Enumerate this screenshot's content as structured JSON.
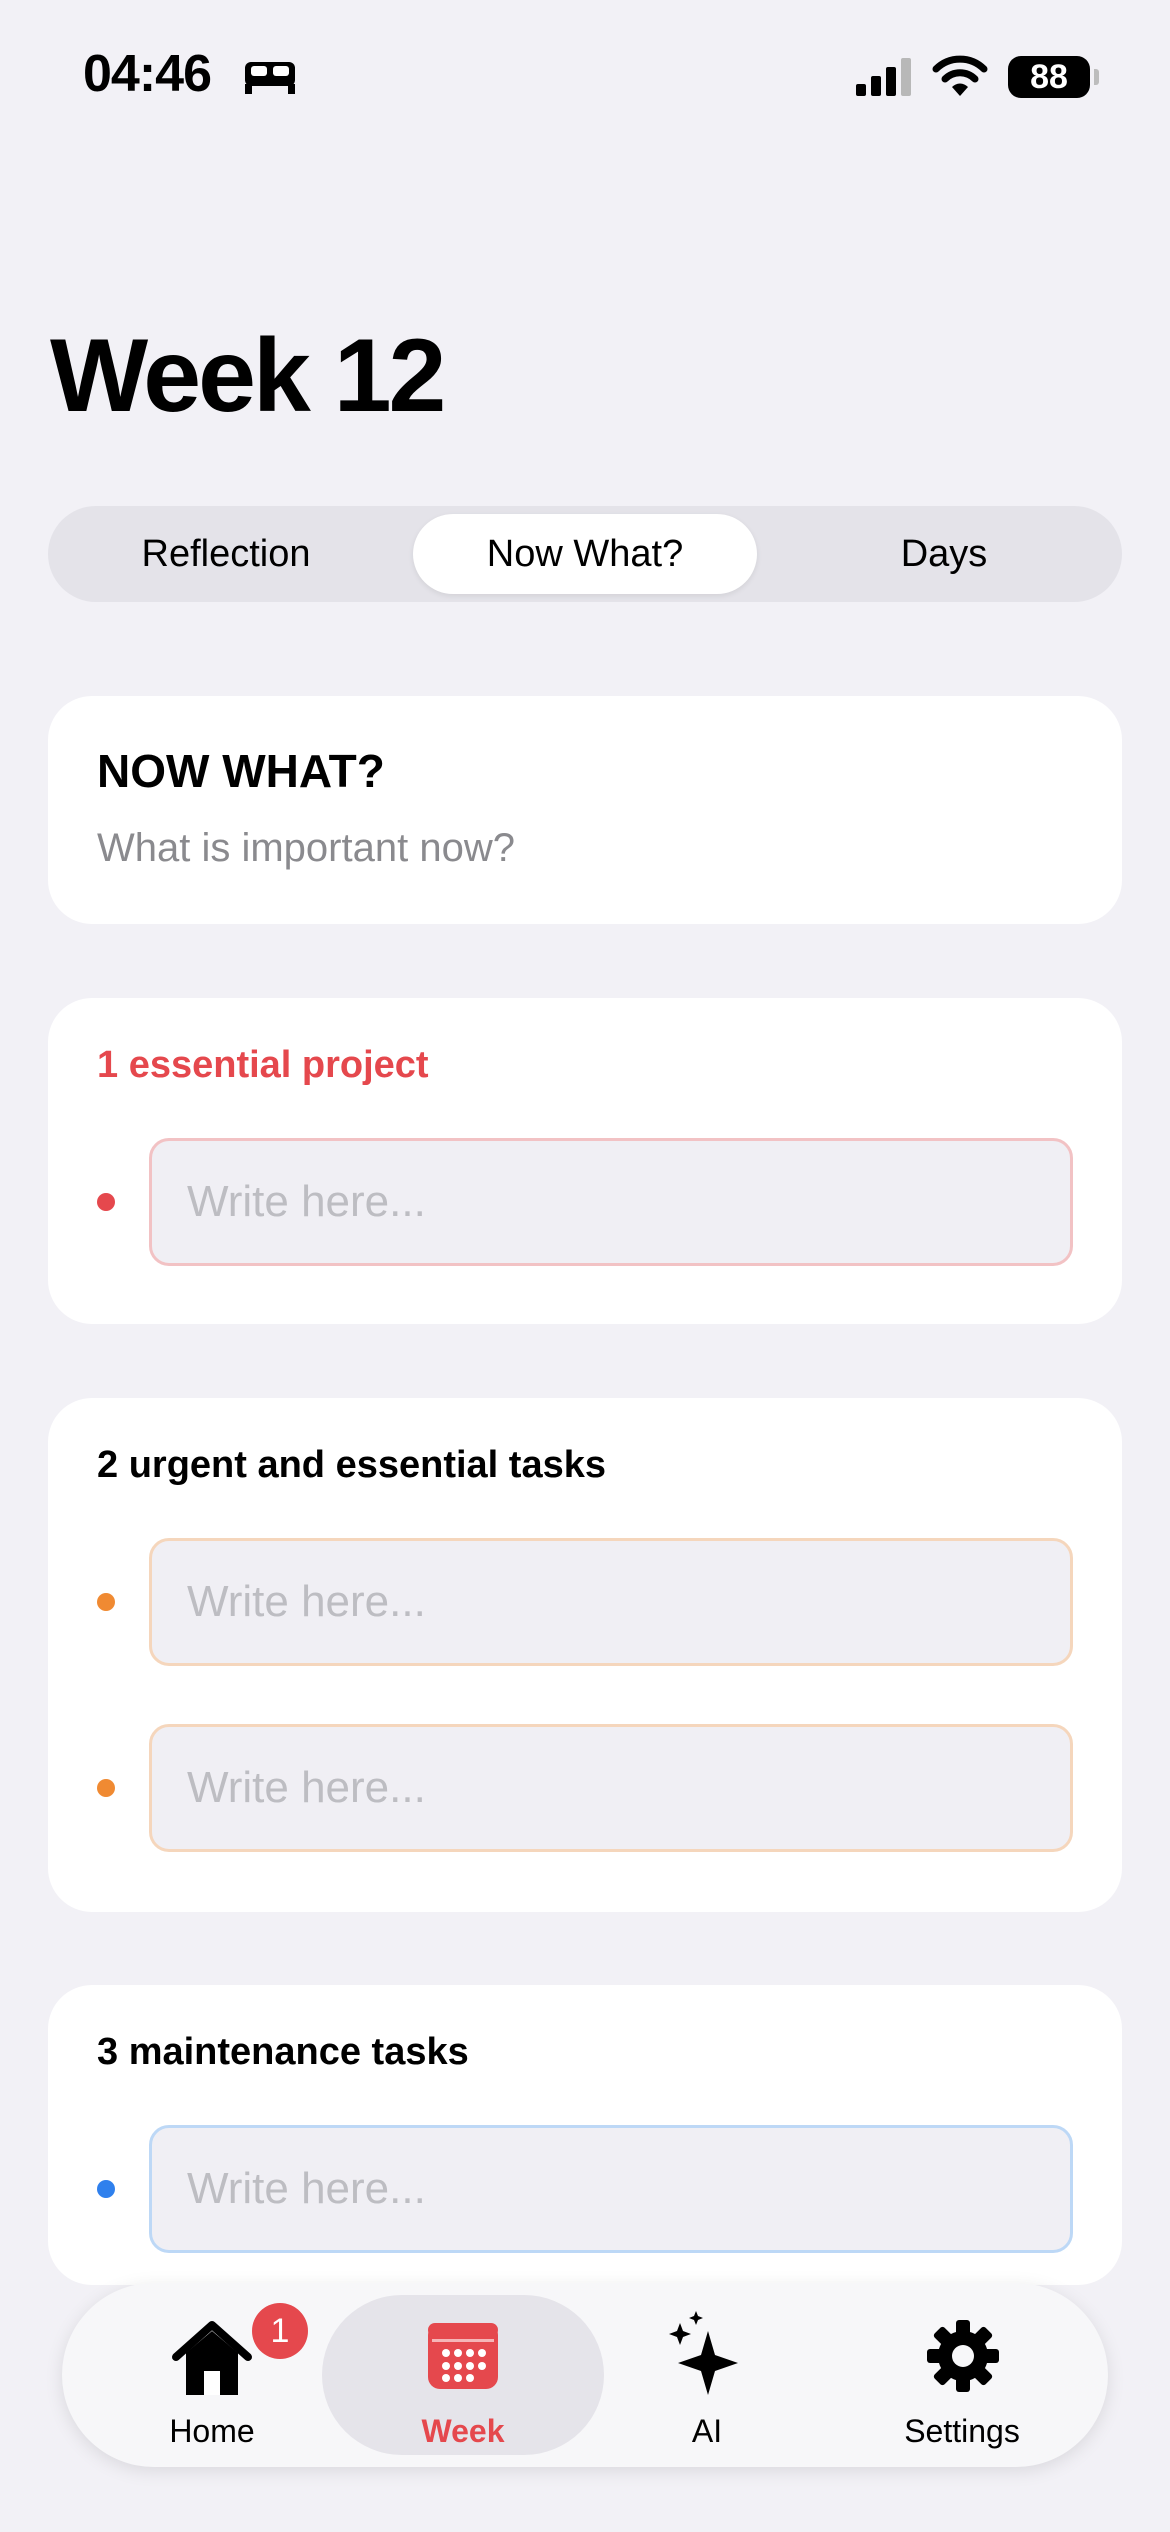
{
  "status_bar": {
    "time": "04:46",
    "battery": "88"
  },
  "page": {
    "title": "Week 12"
  },
  "segments": [
    "Reflection",
    "Now What?",
    "Days"
  ],
  "segment_selected": "Now What?",
  "intro_card": {
    "heading": "NOW WHAT?",
    "subtitle": "What is important now?"
  },
  "sections": [
    {
      "title": "1 essential project",
      "title_color": "#E5484D",
      "dot_color": "#E5484D",
      "placeholder": "Write here..."
    },
    {
      "title": "2 urgent and essential tasks",
      "title_color": "#000000",
      "dot_color": "#F08A32",
      "placeholder": "Write here..."
    },
    {
      "title": "3 maintenance tasks",
      "title_color": "#000000",
      "dot_color": "#2F80ED",
      "placeholder": "Write here..."
    }
  ],
  "tabbar": {
    "items": [
      {
        "label": "Home",
        "icon": "home-icon",
        "badge": "1"
      },
      {
        "label": "Week",
        "icon": "calendar-icon",
        "active": true
      },
      {
        "label": "AI",
        "icon": "sparkles-icon"
      },
      {
        "label": "Settings",
        "icon": "gear-icon"
      }
    ]
  },
  "colors": {
    "accent_red": "#E5484D",
    "orange": "#F08A32",
    "blue": "#2F80ED",
    "background": "#F2F1F6"
  }
}
